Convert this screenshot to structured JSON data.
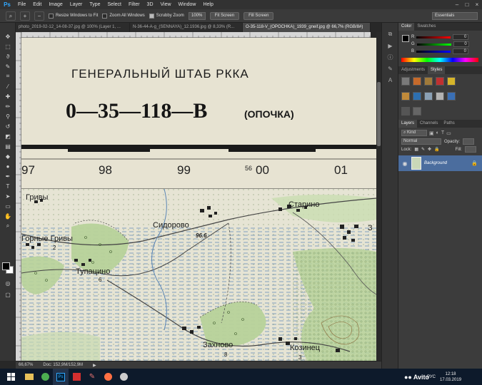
{
  "menu": {
    "logo": "Ps",
    "items": [
      "File",
      "Edit",
      "Image",
      "Layer",
      "Type",
      "Select",
      "Filter",
      "3D",
      "View",
      "Window",
      "Help"
    ],
    "win_min": "–",
    "win_max": "□",
    "win_close": "×"
  },
  "options": {
    "resize_windows": "Resize Windows to Fit",
    "zoom_all": "Zoom All Windows",
    "scrubby_zoom": "Scrubby Zoom",
    "actual_pixels": "100%",
    "fit_screen": "Fit Screen",
    "fill_screen": "Fill Screen",
    "workspace": "Essentials"
  },
  "tabs": [
    {
      "label": "photo_2019-02-12_14-08-37.jpg @ 100% (Layer 1, ..."
    },
    {
      "label": "N-36-44-A-g_(SENNAYA)_12.1936.jpg @ 8,33% (R..."
    },
    {
      "label": "O-35-118-V_(OPOCHKA)_1939_gneif.jpg @ 66,7% (RGB/8#)"
    }
  ],
  "map": {
    "header1": "ГЕНЕРАЛЬНЫЙ ШТАБ РККА",
    "sheet_code": "0—35—118—В",
    "sheet_name": "(ОПОЧКА)",
    "grid_labels": [
      "97",
      "98",
      "99",
      "56",
      "00",
      "01"
    ],
    "places": [
      "Гривы",
      "Сидорово",
      "96.6",
      "Горные Гривы",
      "2",
      "Тупацино",
      "6",
      "Старино",
      "Захново",
      "8",
      "Козинец",
      "3",
      "З"
    ]
  },
  "status": {
    "zoom": "66,67%",
    "doc": "Doc: 152,9M/152,9M"
  },
  "color_panel": {
    "tabs": [
      "Color",
      "Swatches"
    ],
    "rows": [
      {
        "label": "R",
        "value": "0"
      },
      {
        "label": "G",
        "value": "0"
      },
      {
        "label": "B",
        "value": "0"
      }
    ]
  },
  "styles_panel": {
    "tabs": [
      "Adjustments",
      "Styles"
    ]
  },
  "layers_panel": {
    "tabs": [
      "Layers",
      "Channels",
      "Paths"
    ],
    "filter_kind": "Kind",
    "blend_mode": "Normal",
    "opacity_label": "Opacity:",
    "lock_label": "Lock:",
    "fill_label": "Fill:",
    "layer_name": "Background"
  },
  "taskbar": {
    "lang": "РУС",
    "time": "12:18",
    "date": "17.03.2019",
    "watermark": "Avito"
  },
  "colors": {
    "ps_blue": "#31a8ff",
    "map_paper": "#e7e3d2",
    "forest_green": "#b7d29a",
    "water_blue": "#5b86b5",
    "layer_select": "#4b6d9e"
  }
}
